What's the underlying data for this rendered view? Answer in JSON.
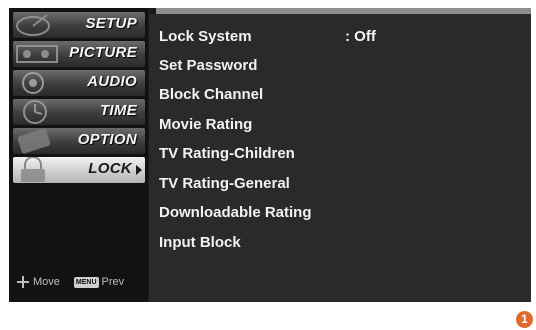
{
  "sidebar": {
    "tabs": [
      {
        "label": "SETUP",
        "icon": "satellite-dish-icon"
      },
      {
        "label": "PICTURE",
        "icon": "film-reel-icon"
      },
      {
        "label": "AUDIO",
        "icon": "speaker-icon"
      },
      {
        "label": "TIME",
        "icon": "clock-icon"
      },
      {
        "label": "OPTION",
        "icon": "option-card-icon"
      },
      {
        "label": "LOCK",
        "icon": "lock-icon",
        "active": true
      }
    ],
    "hint_move": "Move",
    "hint_menu_key": "MENU",
    "hint_prev": "Prev"
  },
  "lock_menu": {
    "items": [
      {
        "label": "Lock System",
        "value": ": Off"
      },
      {
        "label": "Set Password"
      },
      {
        "label": "Block Channel"
      },
      {
        "label": "Movie Rating"
      },
      {
        "label": "TV Rating-Children"
      },
      {
        "label": "TV Rating-General"
      },
      {
        "label": "Downloadable Rating"
      },
      {
        "label": "Input Block"
      }
    ]
  },
  "page_badge": "1",
  "colors": {
    "accent_badge": "#e06a2e",
    "panel": "#2a2a2a",
    "sidebar": "#121212"
  }
}
